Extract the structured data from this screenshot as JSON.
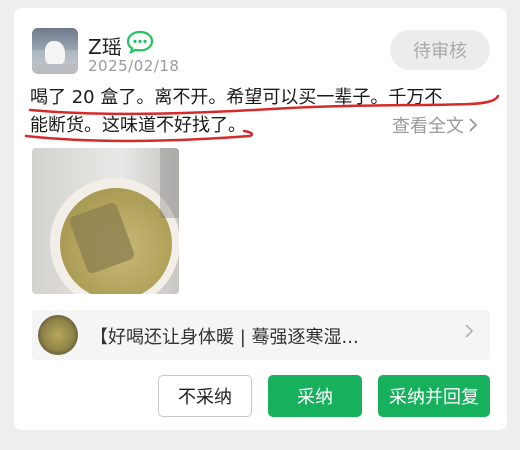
{
  "user": {
    "name": "Z瑶",
    "date": "2025/02/18",
    "status_label": "待审核"
  },
  "post": {
    "line1": "喝了 20 盒了。离不开。希望可以买一辈子。千万不",
    "line2": "能断货。这味道不好找了。",
    "expand_label": "查看全文"
  },
  "link": {
    "title": "【好喝还让身体暖 | 蓦强逐寒湿..."
  },
  "actions": {
    "reject_label": "不采纳",
    "accept_label": "采纳",
    "accept_reply_label": "采纳并回复"
  },
  "colors": {
    "accent": "#17b05c",
    "annotation_red": "#d62a2a",
    "chat_icon": "#22c35e"
  },
  "icons": [
    "avatar-image",
    "chat-bubble-icon",
    "chevron-right-icon",
    "tea-photo",
    "link-thumbnail"
  ]
}
